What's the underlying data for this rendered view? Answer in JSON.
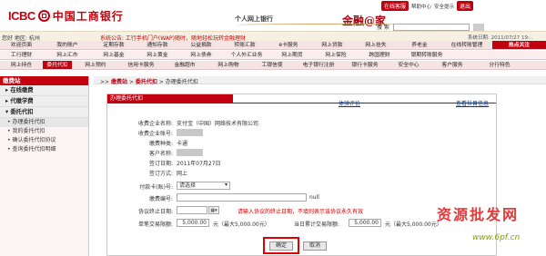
{
  "header": {
    "logo_icbc": "ICBC",
    "logo_cn": "中国工商银行",
    "subtitle": "个人网上银行",
    "brand": "金融@家",
    "online_service": "在线客服",
    "links": [
      "帮助中心",
      "安全提示",
      "退出"
    ]
  },
  "infobar": {
    "user_text": "您好 地区: 杭州",
    "news_text": "系统公告: 工行手机门户(WAP)随时，随地轻松玩转金融理财",
    "date_text": "系统日期: 2011/07/27 19:..",
    "search_label": "搜 索"
  },
  "nav": {
    "row1": [
      "欢迎页面",
      "我的账户",
      "定期存款",
      "通知存款",
      "公益捐款",
      "转账汇款",
      "e卡服务",
      "网上贷款",
      "网上挂失",
      "养老金",
      "在线转账管理",
      "热点关注"
    ],
    "row2": [
      "工行理财",
      "网上汇市",
      "网上基金",
      "网上黄金",
      "网上债券",
      "个人外汇业务",
      "网上期货",
      "网上保险",
      "跨国理财",
      "银期转账服务"
    ],
    "row3": [
      "网上持仓",
      "委托代扣",
      "网上预约",
      "信用卡服务",
      "金融超市",
      "网上购物",
      "工银信使",
      "电子银行注册",
      "银行卡服务",
      "安全中心",
      "客户服务",
      "分行特色"
    ],
    "active_tab": "委托代扣",
    "hot_label": "热点关注"
  },
  "sidebar": {
    "title": "缴费站",
    "groups": [
      {
        "label": "在线缴费",
        "items": []
      },
      {
        "label": "代缴学费",
        "items": []
      },
      {
        "label": "委托代扣",
        "items": [
          "办理委托代扣",
          "我的委托代扣",
          "确认委托代扣协议",
          "查询委托代扣明细"
        ]
      }
    ]
  },
  "breadcrumb": {
    "prefix": ">>",
    "items": [
      "缴费站",
      "委托代扣",
      "办理委托代扣"
    ]
  },
  "panel": {
    "title": "办理委托代扣",
    "link_left": "体验评价",
    "link_right": "查看栏目信息"
  },
  "form": {
    "rows": [
      {
        "label": "收费企业名称:",
        "value": "支付宝（中国）网络技术有限公司"
      },
      {
        "label": "收费企业账号:",
        "value": ""
      },
      {
        "label": "缴费种类:",
        "value": "卡通"
      },
      {
        "label": "客户名称:",
        "value": ""
      },
      {
        "label": "签订日期:",
        "value": "2011年07月27日"
      },
      {
        "label": "签订方式:",
        "value": "网上"
      }
    ],
    "card_label": "付款卡(账)号:",
    "card_placeholder": "请选择",
    "pay_no_label": "缴费编号:",
    "pay_no_suffix": "null",
    "expire_label": "协议终止日期:",
    "expire_hint": "请输入协议的终止日期，不填则表示该协议永久有效",
    "single_limit_label": "单笔交易限额:",
    "single_limit_value": "5,000.00",
    "single_limit_unit": "元（最大5,000.00元）",
    "daily_limit_label": "当日累计交易限额:",
    "daily_limit_value": "5,000.00",
    "daily_limit_unit": "元（最大5,000.00元）",
    "confirm_label": "确定",
    "cancel_label": "取消"
  },
  "watermark": {
    "text": "资源批发网",
    "url": "www.6pf.cn"
  }
}
